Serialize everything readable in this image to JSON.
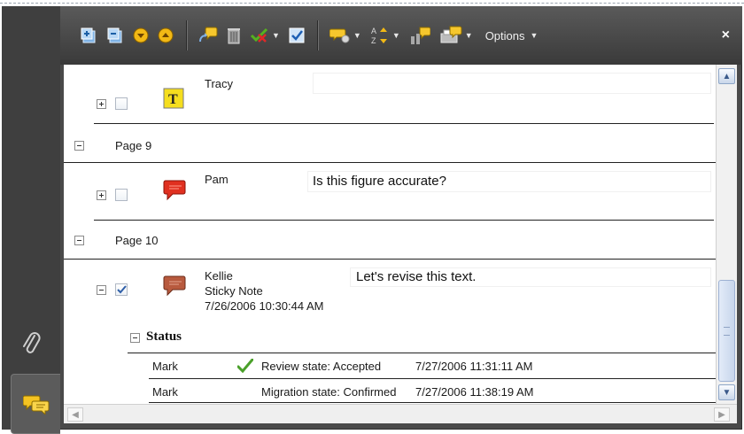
{
  "toolbar": {
    "icons": [
      "new-page-icon",
      "collapse-page-icon",
      "next-down-icon",
      "previous-up-icon",
      "reply-icon",
      "delete-trash-icon",
      "set-status-icon",
      "checkmark-icon",
      "show-comments-icon",
      "sort-icon",
      "filter-icon",
      "summarize-icon"
    ],
    "options_label": "Options",
    "close_label": "×"
  },
  "sidebar": {
    "icons": [
      "paperclip-icon",
      "comments-icon"
    ]
  },
  "comments": {
    "c1": {
      "author": "Tracy",
      "icon": "text-t-icon"
    },
    "page9": {
      "label": "Page 9"
    },
    "c2": {
      "author": "Pam",
      "message": "Is this figure accurate?",
      "icon": "speech-bubble-red-icon"
    },
    "page10": {
      "label": "Page 10"
    },
    "c3": {
      "author": "Kellie",
      "type": "Sticky Note",
      "date": "7/26/2006 10:30:44 AM",
      "message": "Let's revise this text.",
      "icon": "speech-bubble-brown-icon"
    },
    "status": {
      "heading": "Status",
      "rows": [
        {
          "name": "Mark",
          "state": "Review state: Accepted",
          "date": "7/27/2006 11:31:11 AM"
        },
        {
          "name": "Mark",
          "state": "Migration state: Confirmed",
          "date": "7/27/2006 11:38:19 AM"
        }
      ]
    }
  },
  "scrollbar": {
    "up": "▲",
    "down": "▼",
    "left": "◀",
    "right": "▶"
  }
}
